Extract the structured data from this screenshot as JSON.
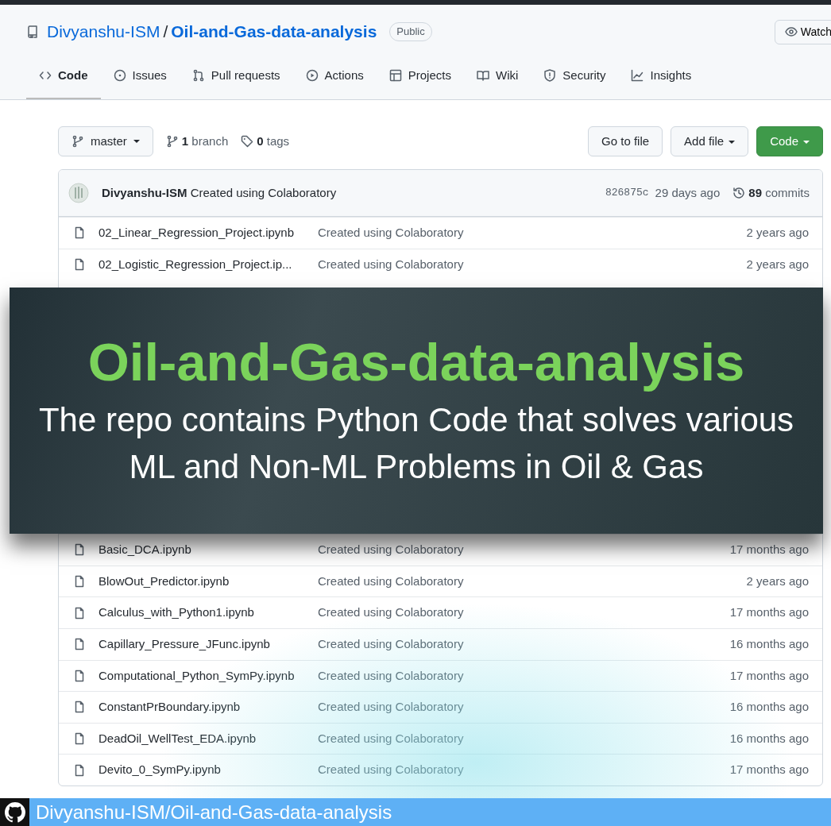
{
  "repo": {
    "owner": "Divyanshu-ISM",
    "separator": "/",
    "name": "Oil-and-Gas-data-analysis",
    "visibility": "Public",
    "watch_button": "Watch"
  },
  "tabs": [
    {
      "label": "Code",
      "selected": true
    },
    {
      "label": "Issues",
      "selected": false
    },
    {
      "label": "Pull requests",
      "selected": false
    },
    {
      "label": "Actions",
      "selected": false
    },
    {
      "label": "Projects",
      "selected": false
    },
    {
      "label": "Wiki",
      "selected": false
    },
    {
      "label": "Security",
      "selected": false
    },
    {
      "label": "Insights",
      "selected": false
    }
  ],
  "toolbar": {
    "branch_select": "master",
    "branch_count": "1",
    "branch_label": "branch",
    "tag_count": "0",
    "tag_label": "tags",
    "go_to_file": "Go to file",
    "add_file": "Add file",
    "code_button": "Code"
  },
  "commit": {
    "author": "Divyanshu-ISM",
    "message": "Created using Colaboratory",
    "hash": "826875c",
    "time": "29 days ago",
    "count": "89",
    "count_label": "commits"
  },
  "files_top": [
    {
      "name": "02_Linear_Regression_Project.ipynb",
      "message": "Created using Colaboratory",
      "time": "2 years ago"
    },
    {
      "name": "02_Logistic_Regression_Project.ip...",
      "message": "Created using Colaboratory",
      "time": "2 years ago"
    }
  ],
  "files_bottom": [
    {
      "name": "Basic_DCA.ipynb",
      "message": "Created using Colaboratory",
      "time": "17 months ago"
    },
    {
      "name": "BlowOut_Predictor.ipynb",
      "message": "Created using Colaboratory",
      "time": "2 years ago"
    },
    {
      "name": "Calculus_with_Python1.ipynb",
      "message": "Created using Colaboratory",
      "time": "17 months ago"
    },
    {
      "name": "Capillary_Pressure_JFunc.ipynb",
      "message": "Created using Colaboratory",
      "time": "16 months ago"
    },
    {
      "name": "Computational_Python_SymPy.ipynb",
      "message": "Created using Colaboratory",
      "time": "17 months ago"
    },
    {
      "name": "ConstantPrBoundary.ipynb",
      "message": "Created using Colaboratory",
      "time": "16 months ago"
    },
    {
      "name": "DeadOil_WellTest_EDA.ipynb",
      "message": "Created using Colaboratory",
      "time": "16 months ago"
    },
    {
      "name": "Devito_0_SymPy.ipynb",
      "message": "Created using Colaboratory",
      "time": "17 months ago"
    }
  ],
  "banner": {
    "title": "Oil-and-Gas-data-analysis",
    "subtitle": "The repo contains Python Code that solves various ML and Non-ML Problems in Oil & Gas"
  },
  "footer": {
    "text": "Divyanshu-ISM/Oil-and-Gas-data-analysis"
  }
}
